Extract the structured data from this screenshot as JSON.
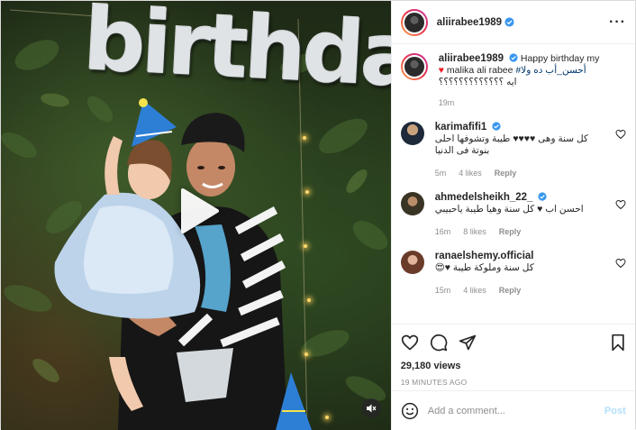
{
  "media": {
    "balloon_text": "birthda",
    "play_icon": "play-icon",
    "mute_icon": "mute-icon"
  },
  "header": {
    "username": "aliirabee1989",
    "verified": true,
    "more_icon": "more-icon"
  },
  "caption": {
    "username": "aliirabee1989",
    "text_1": "Happy birthday my",
    "heart": "♥",
    "text_2": "malika ali rabee",
    "hashtag": "#أحسن_أب ده ولا",
    "text_3": "ايه ؟؟؟؟؟؟؟؟؟؟؟؟؟",
    "time": "19m"
  },
  "comments": [
    {
      "username": "karimafifi1",
      "verified": true,
      "text": "كل سنة وهى ♥♥♥♥ طيبة وتشوفها احلى بنوتة فى الدنيا",
      "time": "5m",
      "likes": "4 likes",
      "reply": "Reply"
    },
    {
      "username": "ahmedelsheikh_22_",
      "verified": true,
      "text": "احسن اب ♥ كل سنة وهيا طيبة ياحبيبي",
      "time": "16m",
      "likes": "8 likes",
      "reply": "Reply"
    },
    {
      "username": "ranaelshemy.official",
      "verified": false,
      "text": "كل سنة وملوكة طيبة ♥😍",
      "time": "15m",
      "likes": "4 likes",
      "reply": "Reply"
    }
  ],
  "actions": {
    "like_icon": "heart-outline-icon",
    "comment_icon": "comment-icon",
    "share_icon": "paper-plane-icon",
    "save_icon": "bookmark-icon",
    "views": "29,180 views",
    "posted": "19 MINUTES AGO"
  },
  "add_comment": {
    "emoji_icon": "smiley-icon",
    "placeholder": "Add a comment...",
    "post_label": "Post"
  },
  "colors": {
    "verified_blue": "#3897f0",
    "heart_red": "#ed1c24",
    "link_blue": "#00376b",
    "post_disabled": "#b2dffc"
  }
}
